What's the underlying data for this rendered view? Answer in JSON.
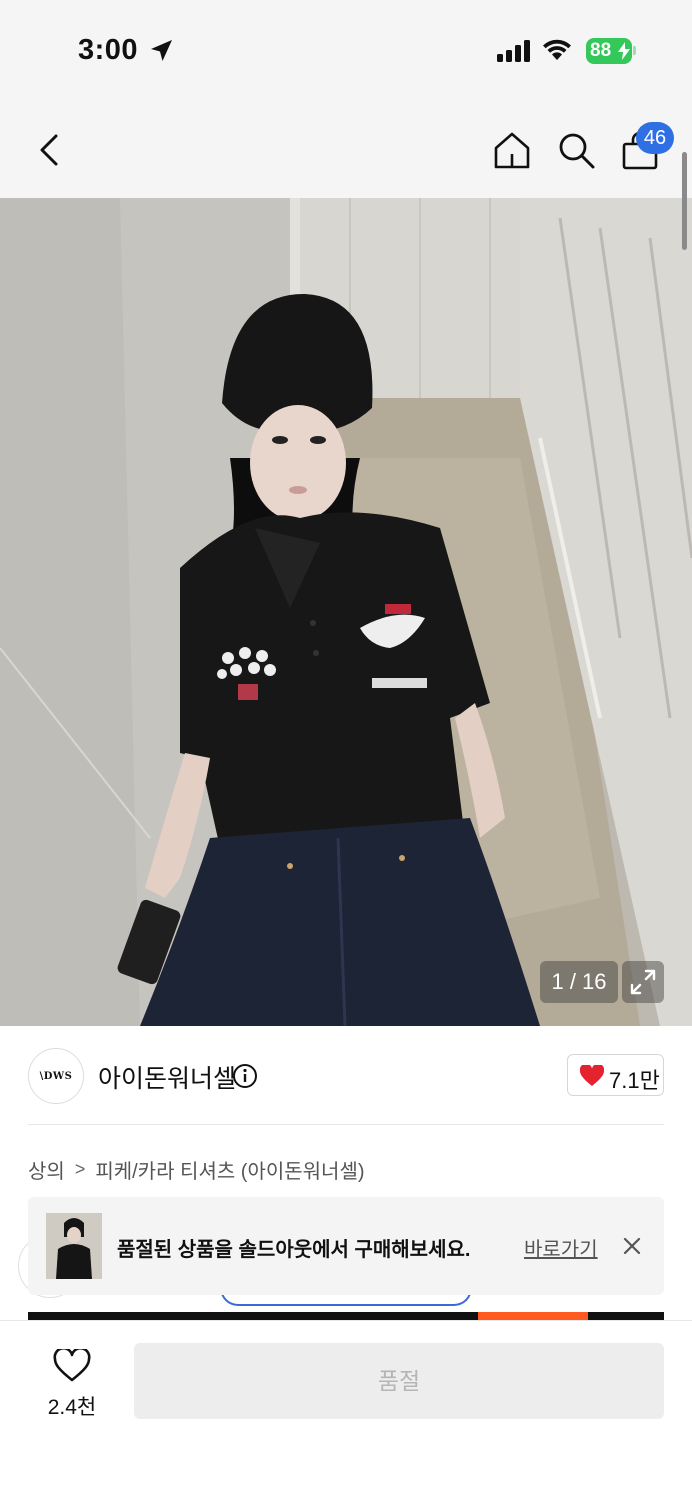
{
  "status_bar": {
    "time": "3:00",
    "battery": "88"
  },
  "nav": {
    "cart_badge": "46"
  },
  "gallery": {
    "counter": "1 / 16"
  },
  "brand": {
    "logo_text": "\\DWS",
    "name": "아이돈워너셀",
    "likes": "7.1만",
    "like_color": "#e5232f"
  },
  "breadcrumb": {
    "category": "상의",
    "separator": ">",
    "subcategory": "피케/카라 티셔츠 (아이돈워너셀)"
  },
  "soldout_banner": {
    "message": "품절된 상품을 솔드아웃에서 구매해보세요.",
    "link_label": "바로가기"
  },
  "bottom_bar": {
    "wish_count": "2.4천",
    "buy_label": "품절"
  },
  "colors": {
    "accent_blue": "#2f6fe4",
    "battery_green": "#34c759"
  }
}
